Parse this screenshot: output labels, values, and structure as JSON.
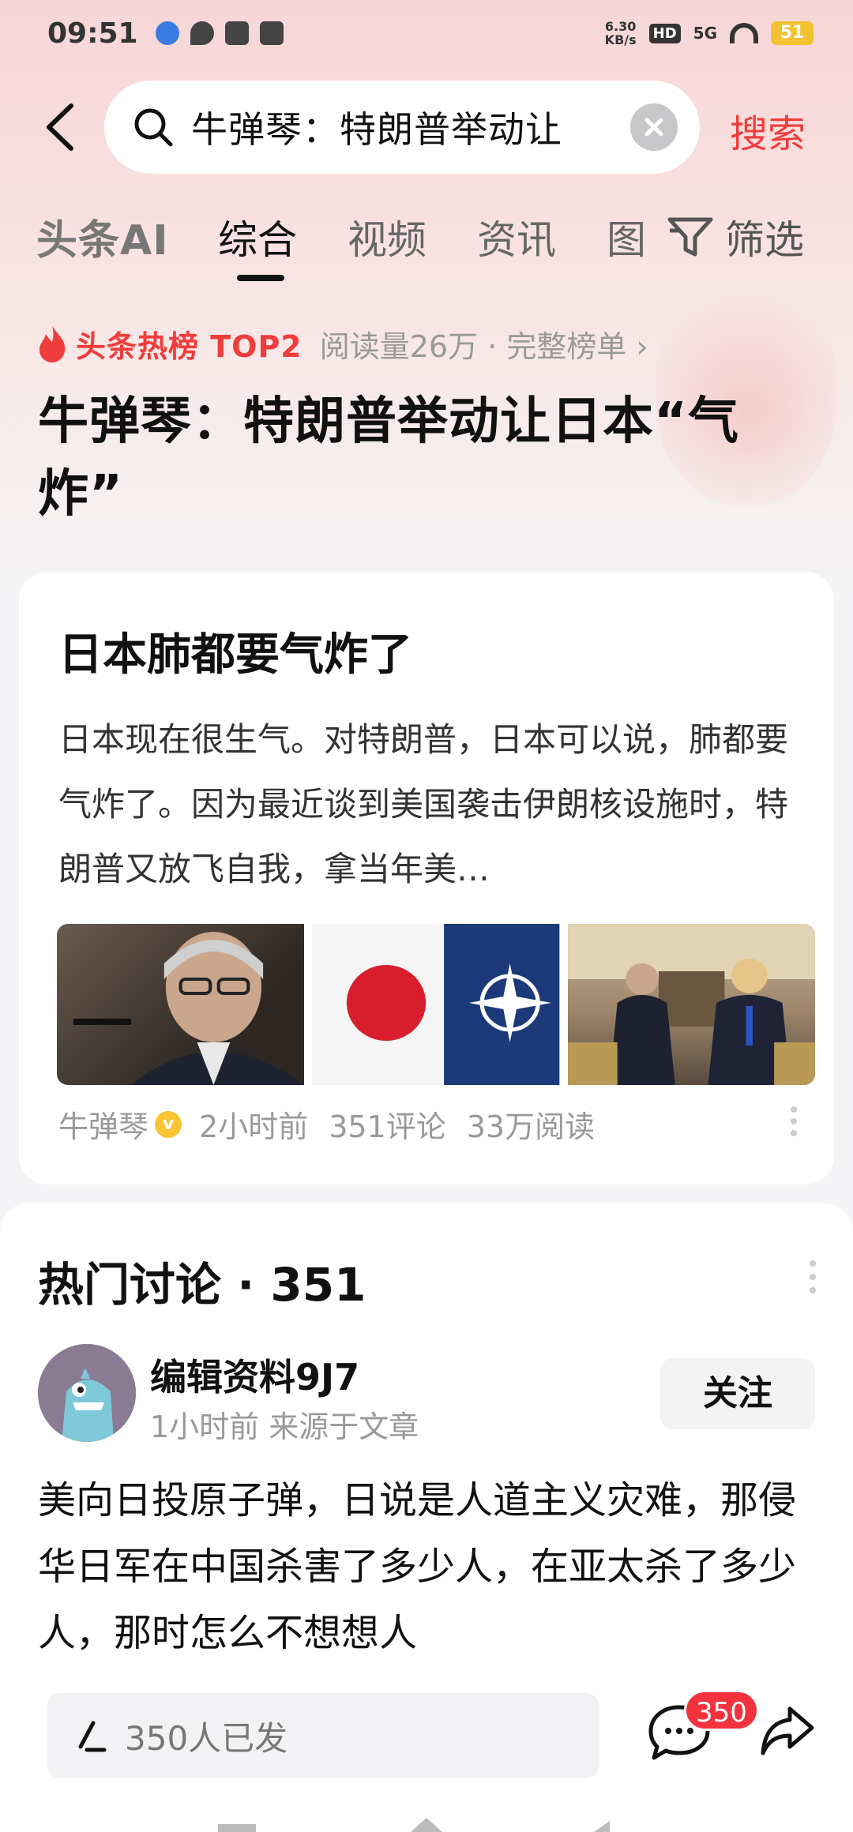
{
  "status_bar": {
    "time": "09:51",
    "speed_value": "6.30",
    "speed_unit": "KB/s",
    "hd": "HD",
    "network": "5G",
    "battery": "51"
  },
  "search": {
    "query": "牛弹琴：特朗普举动让",
    "button_label": "搜索"
  },
  "tabs": {
    "ai_label": "头条AI",
    "items": [
      "综合",
      "视频",
      "资讯",
      "图"
    ],
    "filter_label": "筛选"
  },
  "hot": {
    "label": "头条热榜 TOP2",
    "meta": "阅读量26万 · 完整榜单 ›"
  },
  "headline": "牛弹琴：特朗普举动让日本“气炸”",
  "article": {
    "title": "日本肺都要气炸了",
    "summary": "日本现在很生气。对特朗普，日本可以说，肺都要气炸了。因为最近谈到美国袭击伊朗核设施时，特朗普又放飞自我，拿当年美…",
    "author": "牛弹琴",
    "time": "2小时前",
    "comments": "351评论",
    "reads": "33万阅读"
  },
  "discussion": {
    "title": "热门讨论 · 351",
    "user_name": "编辑资料9J7",
    "user_meta": "1小时前  来源于文章",
    "follow_label": "关注",
    "comment": "美向日投原子弹，日说是人道主义灾难，那侵华日军在中国杀害了多少人，在亚太杀了多少人，那时怎么不想想人"
  },
  "bottom": {
    "reply_placeholder": "350人已发",
    "comment_badge": "350"
  },
  "colors": {
    "accent_red": "#f03c3c",
    "badge_red": "#f2333d",
    "verified_yellow": "#f7c531"
  }
}
